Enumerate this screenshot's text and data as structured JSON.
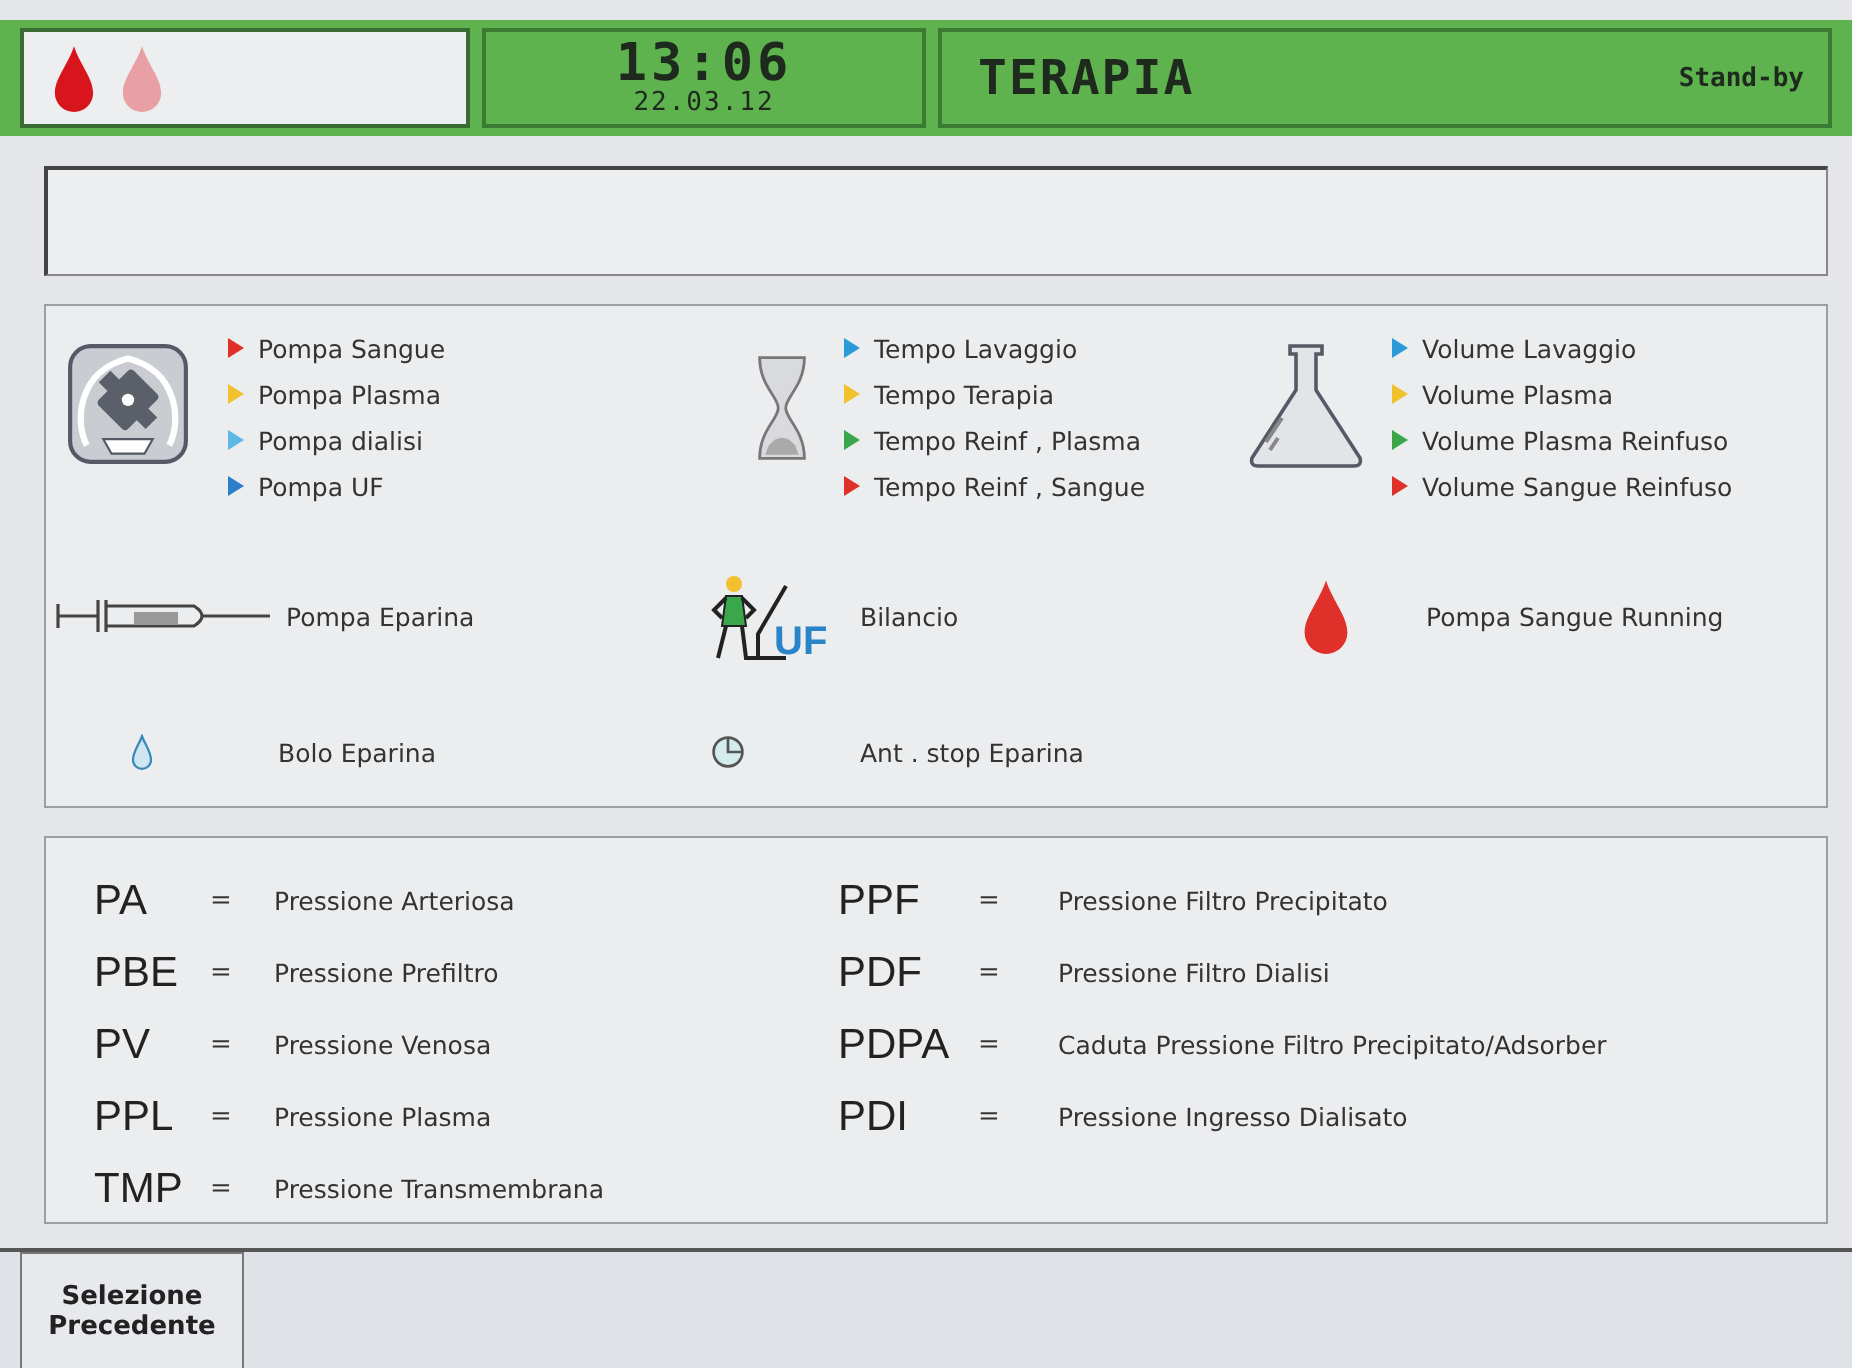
{
  "header": {
    "drops": [
      {
        "color": "#d8141c"
      },
      {
        "color": "#e8a0a4"
      }
    ],
    "time": "13:06",
    "date": "22.03.12",
    "title": "TERAPIA",
    "status": "Stand-by"
  },
  "legend": {
    "groups": [
      {
        "kind": "pump",
        "items": [
          {
            "label": "Pompa Sangue",
            "color": "#e0302a"
          },
          {
            "label": "Pompa Plasma",
            "color": "#f2c12e"
          },
          {
            "label": "Pompa dialisi",
            "color": "#5ab8e8"
          },
          {
            "label": "Pompa UF",
            "color": "#2a7fc8"
          }
        ]
      },
      {
        "kind": "hourglass",
        "items": [
          {
            "label": "Tempo Lavaggio",
            "color": "#2a9ad8"
          },
          {
            "label": "Tempo Terapia",
            "color": "#f2c12e"
          },
          {
            "label": "Tempo Reinf , Plasma",
            "color": "#3aa84a"
          },
          {
            "label": "Tempo Reinf , Sangue",
            "color": "#e0302a"
          }
        ]
      },
      {
        "kind": "flask",
        "items": [
          {
            "label": "Volume Lavaggio",
            "color": "#2a9ad8"
          },
          {
            "label": "Volume Plasma",
            "color": "#f2c12e"
          },
          {
            "label": "Volume Plasma Reinfuso",
            "color": "#3aa84a"
          },
          {
            "label": "Volume Sangue Reinfuso",
            "color": "#e0302a"
          }
        ]
      }
    ],
    "singles": [
      {
        "kind": "syringe",
        "label": "Pompa Eparina"
      },
      {
        "kind": "uf",
        "icon_text": "UF",
        "label": "Bilancio"
      },
      {
        "kind": "blood-drop",
        "label": "Pompa Sangue Running"
      },
      {
        "kind": "small-drop",
        "label": "Bolo Eparina"
      },
      {
        "kind": "timer",
        "label": "Ant . stop Eparina"
      }
    ]
  },
  "abbreviations": {
    "columns": [
      [
        {
          "code": "PA",
          "eq": "=",
          "text": "Pressione Arteriosa"
        },
        {
          "code": "PBE",
          "eq": "=",
          "text": "Pressione Prefiltro"
        },
        {
          "code": "PV",
          "eq": "=",
          "text": "Pressione Venosa"
        },
        {
          "code": "PPL",
          "eq": "=",
          "text": "Pressione Plasma"
        },
        {
          "code": "TMP",
          "eq": "=",
          "text": "Pressione Transmembrana"
        }
      ],
      [
        {
          "code": "PPF",
          "eq": "=",
          "text": "Pressione Filtro Precipitato"
        },
        {
          "code": "PDF",
          "eq": "=",
          "text": "Pressione Filtro Dialisi"
        },
        {
          "code": "PDPA",
          "eq": "=",
          "text": "Caduta Pressione Filtro Precipitato/Adsorber"
        },
        {
          "code": "PDI",
          "eq": "=",
          "text": "Pressione Ingresso Dialisato"
        }
      ]
    ]
  },
  "buttons": [
    {
      "label": "Selezione Precedente"
    }
  ]
}
